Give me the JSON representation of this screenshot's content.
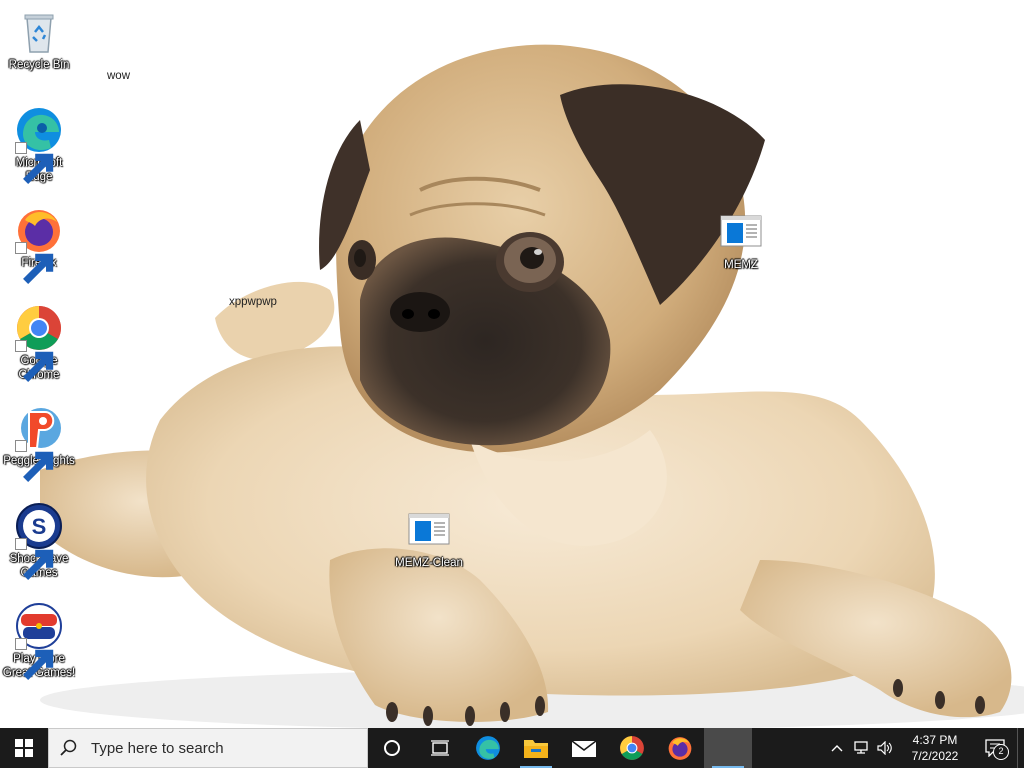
{
  "desktop": {
    "icons": [
      {
        "label": "Recycle Bin",
        "icon": "recycle-bin-icon"
      },
      {
        "label": "Microsoft Edge",
        "icon": "edge-icon"
      },
      {
        "label": "Firefox",
        "icon": "firefox-icon"
      },
      {
        "label": "Google Chrome",
        "icon": "chrome-icon"
      },
      {
        "label": "Peggle Nights",
        "icon": "peggle-icon"
      },
      {
        "label": "Shockwave Games",
        "icon": "shockwave-icon"
      },
      {
        "label": "Play More Great Games!",
        "icon": "popcap-icon"
      },
      {
        "label": "MEMZ",
        "icon": "window-app-icon"
      },
      {
        "label": "MEMZ-Clean",
        "icon": "window-app-icon"
      }
    ],
    "loose_text": [
      "wow",
      "xppwpwp"
    ],
    "wallpaper": "pug-puppy-wallpaper"
  },
  "taskbar": {
    "search_placeholder": "Type here to search",
    "pinned": [
      "cortana-icon",
      "task-view-icon",
      "edge-icon",
      "file-explorer-icon",
      "mail-icon",
      "chrome-icon",
      "firefox-icon",
      "blank-app-icon"
    ],
    "clock": {
      "time": "4:37 PM",
      "date": "7/2/2022"
    },
    "notification_count": "2",
    "colors": {
      "taskbar": "#1b1b1b",
      "accent": "#76b9ed"
    }
  }
}
